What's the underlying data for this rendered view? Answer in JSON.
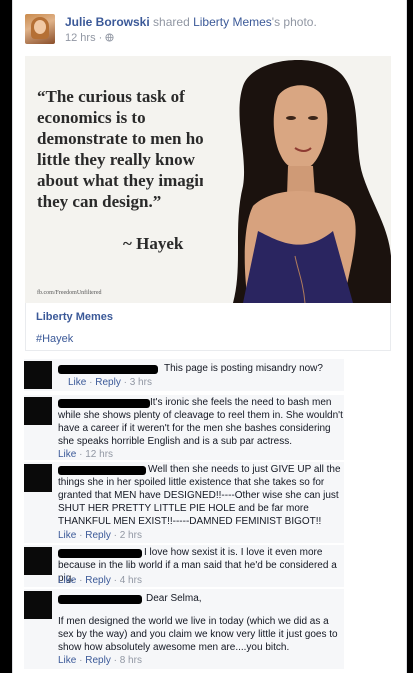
{
  "post": {
    "author": "Julie Borowski",
    "shared_text": "shared",
    "page_name": "Liberty Memes",
    "object_text": "'s photo.",
    "time": "12 hrs",
    "privacy_icon": "globe-icon"
  },
  "photo": {
    "quote": "“The curious task of economics is to demonstrate to men how little they really know about what they imagine they can design.”",
    "attribution": "~ Hayek",
    "credit": "fb.com/FreedomUnfiltered"
  },
  "link": {
    "title": "Liberty Memes",
    "hashtag": "#Hayek"
  },
  "actions": {
    "like": "Like",
    "reply": "Reply",
    "sep": " · "
  },
  "comments": [
    {
      "text": "This page is posting misandry now?",
      "time": "3 hrs"
    },
    {
      "text": "It's ironic she feels the need to bash men while she shows plenty of cleavage to reel them in. She wouldn't have a career if it weren't for the men she bashes considering she speaks horrible English and is a sub par actress.",
      "time": "12 hrs"
    },
    {
      "text": "Well then she needs to just GIVE UP all the things she in her spoiled little existence that she takes so for granted that MEN have DESIGNED!!----Other wise she can just SHUT HER PRETTY LITTLE PIE HOLE and be far more THANKFUL MEN EXIST!!-----DAMNED FEMINIST BIGOT!!",
      "time": "2 hrs"
    },
    {
      "text": "I love how sexist it is. I love it even more because in the lib world if a man said that he'd be considered a pig.",
      "time": "4 hrs"
    },
    {
      "greeting": "Dear Selma,",
      "text": "If men designed the world we live in today (which we did as a sex by the way) and you claim we know very little it just goes to show how absolutely awesome men are....you bitch.",
      "time": "8 hrs"
    }
  ]
}
